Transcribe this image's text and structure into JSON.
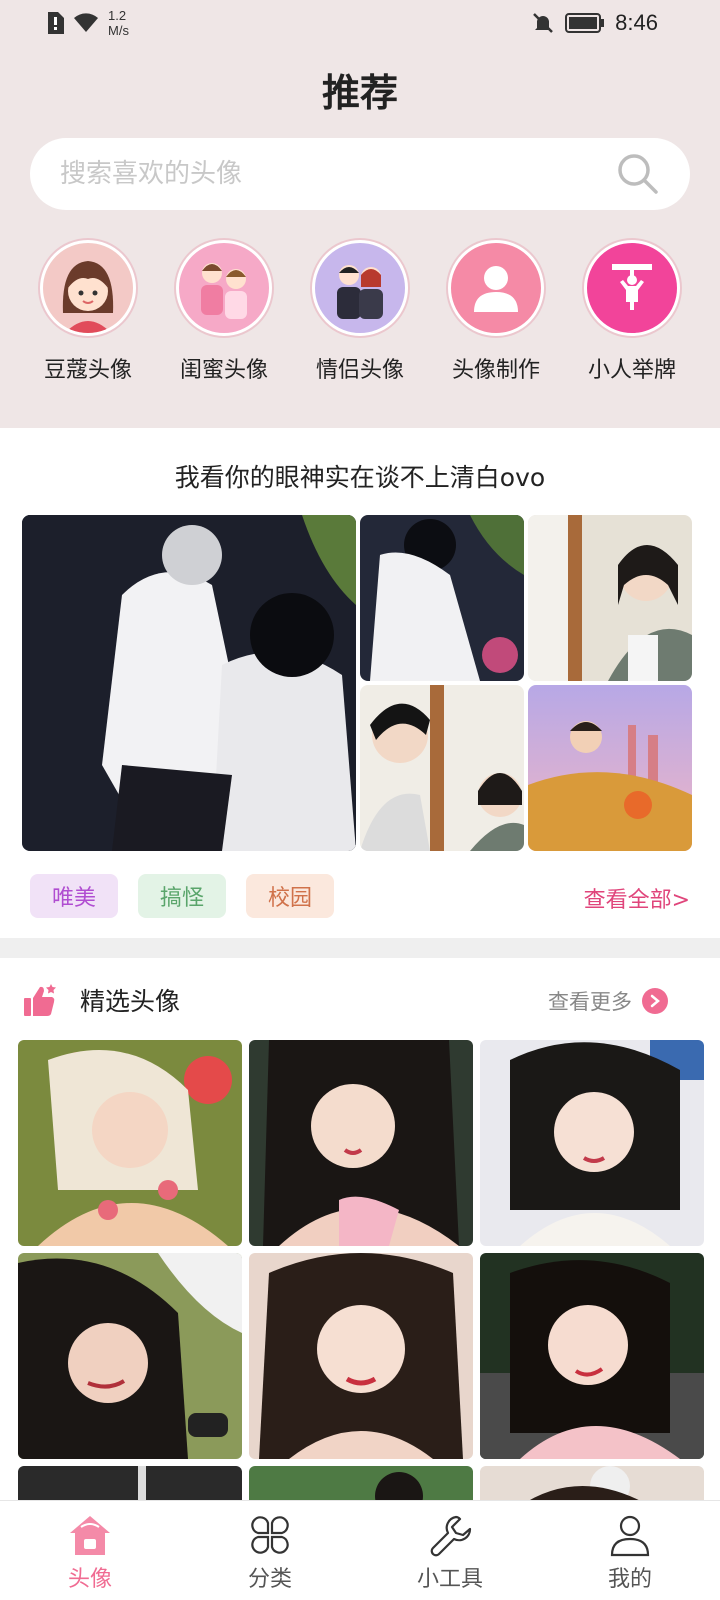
{
  "status_bar": {
    "net_speed": "1.2",
    "net_unit": "M/s",
    "time": "8:46"
  },
  "header": {
    "title": "推荐"
  },
  "search": {
    "placeholder": "搜索喜欢的头像"
  },
  "categories": [
    {
      "label": "豆蔻头像",
      "icon": "girl-avatar-icon"
    },
    {
      "label": "闺蜜头像",
      "icon": "bestie-avatar-icon"
    },
    {
      "label": "情侣头像",
      "icon": "couple-avatar-icon"
    },
    {
      "label": "头像制作",
      "icon": "person-icon"
    },
    {
      "label": "小人举牌",
      "icon": "sign-person-icon"
    }
  ],
  "banner": {
    "title": "我看你的眼神实在谈不上清白ovo",
    "tags": [
      "唯美",
      "搞怪",
      "校园"
    ],
    "view_all": "查看全部>"
  },
  "featured": {
    "title": "精选头像",
    "more": "查看更多"
  },
  "tabbar": [
    {
      "label": "头像",
      "icon": "home-icon",
      "active": true
    },
    {
      "label": "分类",
      "icon": "category-icon",
      "active": false
    },
    {
      "label": "小工具",
      "icon": "wrench-icon",
      "active": false
    },
    {
      "label": "我的",
      "icon": "user-icon",
      "active": false
    }
  ],
  "colors": {
    "accent": "#f06b92",
    "header_bg": "#efe6e6",
    "link": "#e0457b"
  }
}
